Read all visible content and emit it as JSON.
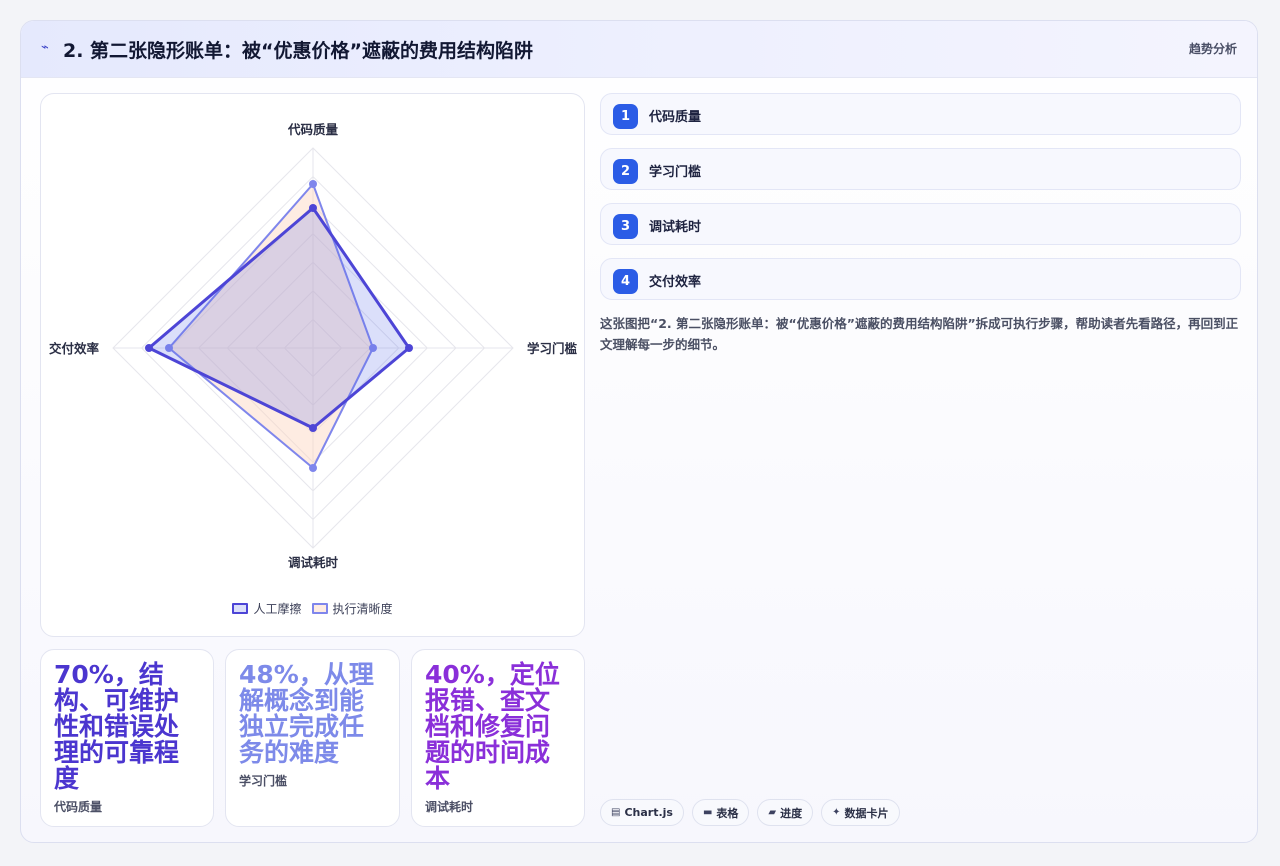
{
  "header": {
    "icon": "trend-line-icon",
    "title": "2. 第二张隐形账单：被“优惠价格”遮蔽的费用结构陷阱",
    "tag": "趋势分析"
  },
  "chart_data": {
    "type": "radar",
    "axes": [
      "代码质量",
      "学习门槛",
      "调试耗时",
      "交付效率"
    ],
    "range": [
      0,
      100
    ],
    "grid_levels": 7,
    "series": [
      {
        "name": "人工摩擦",
        "values": [
          70,
          48,
          40,
          82
        ],
        "stroke": "#4d45d6",
        "fill": "rgba(90,110,230,0.22)"
      },
      {
        "name": "执行清晰度",
        "values": [
          82,
          30,
          60,
          72
        ],
        "stroke": "#7f86ec",
        "fill": "rgba(253,213,190,0.45)"
      }
    ]
  },
  "steps": [
    {
      "num": "1",
      "label": "代码质量"
    },
    {
      "num": "2",
      "label": "学习门槛"
    },
    {
      "num": "3",
      "label": "调试耗时"
    },
    {
      "num": "4",
      "label": "交付效率"
    }
  ],
  "description": "这张图把“2. 第二张隐形账单：被“优惠价格”遮蔽的费用结构陷阱”拆成可执行步骤，帮助读者先看路径，再回到正文理解每一步的细节。",
  "stats": [
    {
      "value": "70%，结构、可维护性和错误处理的可靠程度",
      "label": "代码质量",
      "color": "#4b36cf"
    },
    {
      "value": "48%，从理解概念到能独立完成任务的难度",
      "label": "学习门槛",
      "color": "#7d8ae9"
    },
    {
      "value": "40%，定位报错、查文档和修复问题的时间成本",
      "label": "调试耗时",
      "color": "#8a2fd9"
    }
  ],
  "chips": [
    {
      "icon": "chart-icon",
      "glyph": "▤",
      "label": "Chart.js"
    },
    {
      "icon": "table-icon",
      "glyph": "▬",
      "label": "表格"
    },
    {
      "icon": "progress-icon",
      "glyph": "▰",
      "label": "进度"
    },
    {
      "icon": "sparkle-icon",
      "glyph": "✦",
      "label": "数据卡片"
    }
  ]
}
